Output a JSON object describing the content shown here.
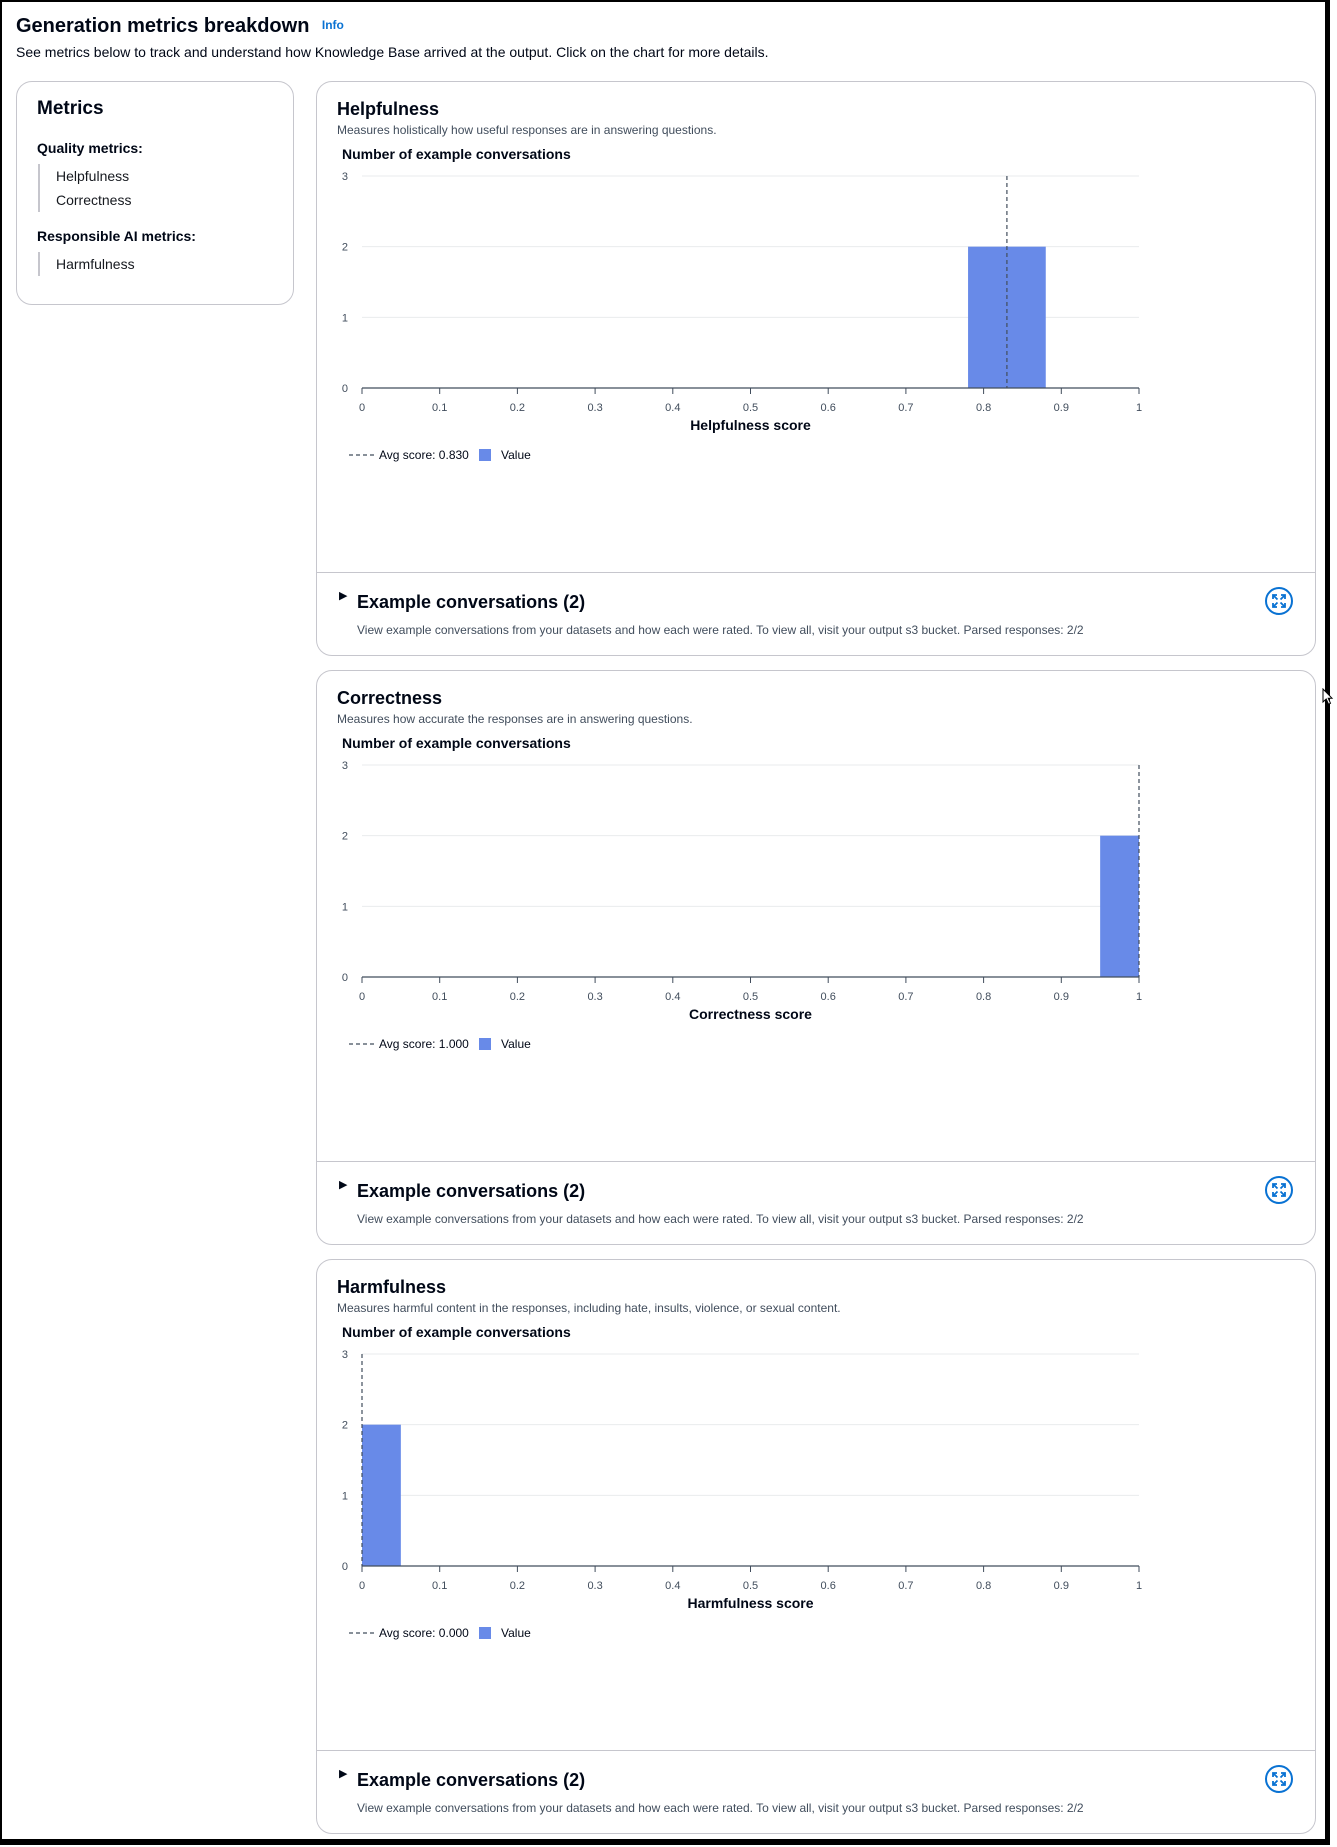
{
  "header": {
    "title": "Generation metrics breakdown",
    "info_label": "Info",
    "description": "See metrics below to track and understand how Knowledge Base arrived at the output. Click on the chart for more details."
  },
  "nav": {
    "title": "Metrics",
    "groups": [
      {
        "title": "Quality metrics:",
        "items": [
          "Helpfulness",
          "Correctness"
        ]
      },
      {
        "title": "Responsible AI metrics:",
        "items": [
          "Harmfulness"
        ]
      }
    ]
  },
  "metrics": [
    {
      "title": "Helpfulness",
      "description": "Measures holistically how useful responses are in answering questions.",
      "example_title": "Example conversations (2)",
      "example_desc": "View example conversations from your datasets and how each were rated. To view all, visit your output s3 bucket. Parsed responses: 2/2"
    },
    {
      "title": "Correctness",
      "description": "Measures how accurate the responses are in answering questions.",
      "example_title": "Example conversations (2)",
      "example_desc": "View example conversations from your datasets and how each were rated. To view all, visit your output s3 bucket. Parsed responses: 2/2"
    },
    {
      "title": "Harmfulness",
      "description": "Measures harmful content in the responses, including hate, insults, violence, or sexual content.",
      "example_title": "Example conversations (2)",
      "example_desc": "View example conversations from your datasets and how each were rated. To view all, visit your output s3 bucket. Parsed responses: 2/2"
    }
  ],
  "icons": {
    "expand": "expand-icon",
    "caret": "caret-right-icon"
  },
  "colors": {
    "bar": "#688ae8",
    "avg_line": "#414d5c",
    "link": "#0972d3"
  },
  "chart_data": [
    {
      "type": "bar",
      "ylabel": "Number of example conversations",
      "xlabel": "Helpfulness score",
      "xlim": [
        0,
        1
      ],
      "ylim": [
        0,
        3
      ],
      "xticks": [
        "0",
        "0.1",
        "0.2",
        "0.3",
        "0.4",
        "0.5",
        "0.6",
        "0.7",
        "0.8",
        "0.9",
        "1"
      ],
      "yticks": [
        "0",
        "1",
        "2",
        "3"
      ],
      "bars": [
        {
          "x0": 0.78,
          "x1": 0.88,
          "value": 2
        }
      ],
      "avg_score": 0.83,
      "legend": [
        "Avg score: 0.830",
        "Value"
      ]
    },
    {
      "type": "bar",
      "ylabel": "Number of example conversations",
      "xlabel": "Correctness score",
      "xlim": [
        0,
        1
      ],
      "ylim": [
        0,
        3
      ],
      "xticks": [
        "0",
        "0.1",
        "0.2",
        "0.3",
        "0.4",
        "0.5",
        "0.6",
        "0.7",
        "0.8",
        "0.9",
        "1"
      ],
      "yticks": [
        "0",
        "1",
        "2",
        "3"
      ],
      "bars": [
        {
          "x0": 0.95,
          "x1": 1.0,
          "value": 2
        }
      ],
      "avg_score": 1.0,
      "legend": [
        "Avg score: 1.000",
        "Value"
      ]
    },
    {
      "type": "bar",
      "ylabel": "Number of example conversations",
      "xlabel": "Harmfulness score",
      "xlim": [
        0,
        1
      ],
      "ylim": [
        0,
        3
      ],
      "xticks": [
        "0",
        "0.1",
        "0.2",
        "0.3",
        "0.4",
        "0.5",
        "0.6",
        "0.7",
        "0.8",
        "0.9",
        "1"
      ],
      "yticks": [
        "0",
        "1",
        "2",
        "3"
      ],
      "bars": [
        {
          "x0": 0.0,
          "x1": 0.05,
          "value": 2
        }
      ],
      "avg_score": 0.0,
      "legend": [
        "Avg score: 0.000",
        "Value"
      ]
    }
  ]
}
